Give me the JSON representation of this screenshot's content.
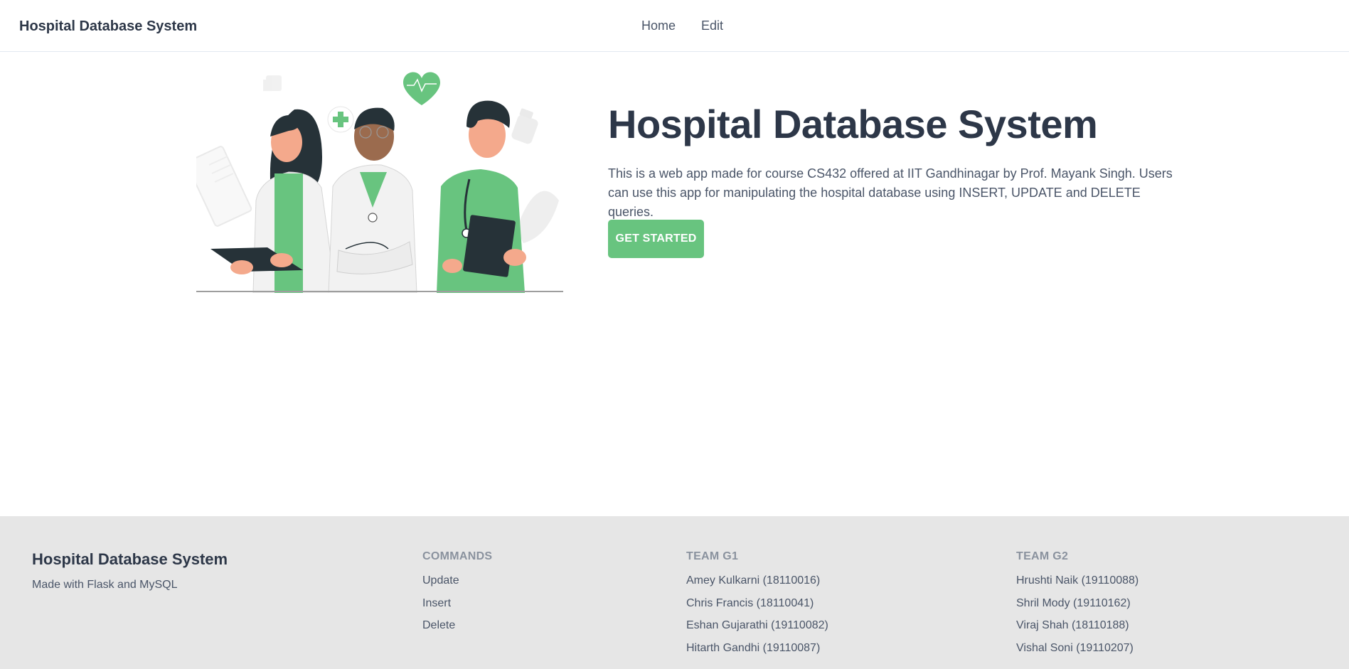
{
  "nav": {
    "brand": "Hospital Database System",
    "links": [
      "Home",
      "Edit"
    ]
  },
  "hero": {
    "title": "Hospital Database System",
    "description": "This is a web app made for course CS432 offered at IIT Gandhinagar by Prof. Mayank Singh. Users can use this app for manipulating the hospital database using INSERT, UPDATE and DELETE queries.",
    "cta_label": "GET STARTED"
  },
  "footer": {
    "brand": "Hospital Database System",
    "tagline": "Made with Flask and MySQL",
    "commands": {
      "heading": "COMMANDS",
      "items": [
        "Update",
        "Insert",
        "Delete"
      ]
    },
    "team_g1": {
      "heading": "TEAM G1",
      "members": [
        "Amey Kulkarni (18110016)",
        "Chris Francis (18110041)",
        "Eshan Gujarathi (19110082)",
        "Hitarth Gandhi (19110087)"
      ]
    },
    "team_g2": {
      "heading": "TEAM G2",
      "members": [
        "Hrushti Naik (19110088)",
        "Shril Mody (19110162)",
        "Viraj Shah (18110188)",
        "Vishal Soni (19110207)"
      ]
    }
  },
  "colors": {
    "accent": "#68c47f",
    "text_dark": "#2d3748",
    "text_body": "#4a5568",
    "footer_bg": "#e6e6e6"
  },
  "icons": [
    "heart-icon",
    "plus-icon",
    "thumbs-up-icon",
    "pill-bottle-icon",
    "clipboard-icon"
  ]
}
